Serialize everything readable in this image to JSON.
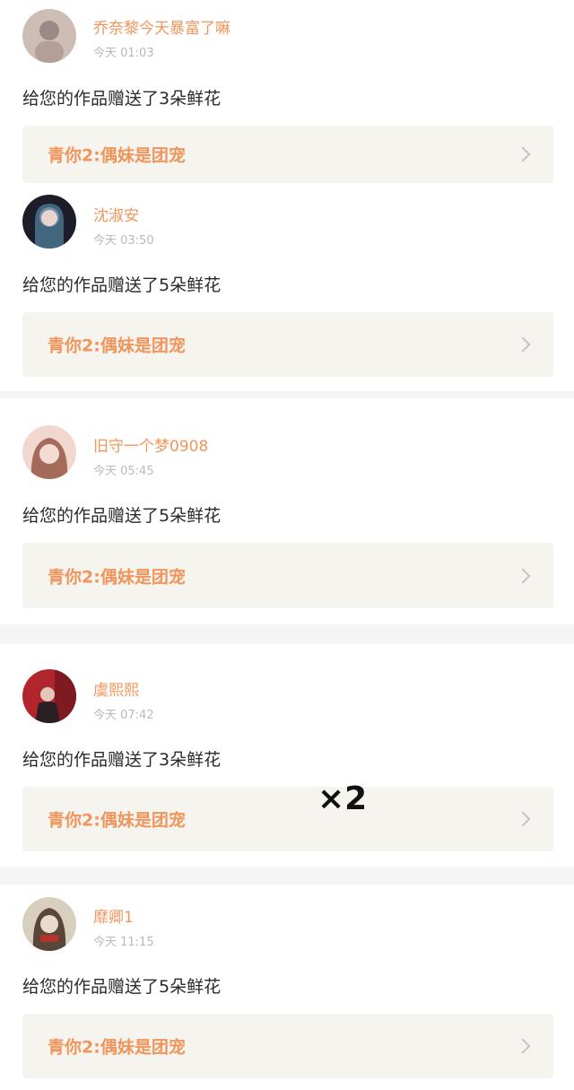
{
  "zoom_label": "×2",
  "items": [
    {
      "name": "乔奈黎今天暴富了嘛",
      "time": "今天 01:03",
      "message": "给您的作品赠送了3朵鲜花",
      "work_title": "青你2:偶妹是团宠",
      "avatar_colors": [
        "#cdbdb4",
        "#9a8a86"
      ]
    },
    {
      "name": "沈淑安",
      "time": "今天 03:50",
      "message": "给您的作品赠送了5朵鲜花",
      "work_title": "青你2:偶妹是团宠",
      "avatar_colors": [
        "#1d1d2a",
        "#4f7f9a"
      ]
    },
    {
      "name": "旧守一个梦0908",
      "time": "今天 05:45",
      "message": "给您的作品赠送了5朵鲜花",
      "work_title": "青你2:偶妹是团宠",
      "avatar_colors": [
        "#f2d7cf",
        "#a46b5a"
      ]
    },
    {
      "name": "虞熙熙",
      "time": "今天 07:42",
      "message": "给您的作品赠送了3朵鲜花",
      "work_title": "青你2:偶妹是团宠",
      "avatar_colors": [
        "#b0262c",
        "#2a1f24"
      ]
    },
    {
      "name": "靡卿1",
      "time": "今天 11:15",
      "message": "给您的作品赠送了5朵鲜花",
      "work_title": "青你2:偶妹是团宠",
      "avatar_colors": [
        "#d8cfbf",
        "#5a4638"
      ]
    }
  ]
}
